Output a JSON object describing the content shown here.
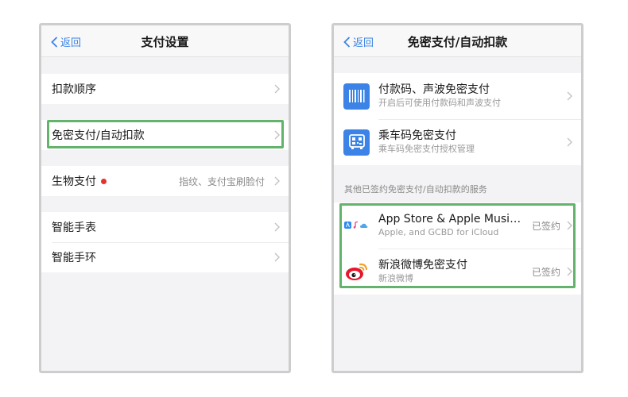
{
  "left": {
    "back_label": "返回",
    "title": "支付设置",
    "groups": [
      [
        {
          "label": "扣款顺序"
        }
      ],
      [
        {
          "label": "免密支付/自动扣款"
        }
      ],
      [
        {
          "label": "生物支付",
          "value": "指纹、支付宝刷脸付"
        }
      ],
      [
        {
          "label": "智能手表"
        },
        {
          "label": "智能手环"
        }
      ]
    ]
  },
  "right": {
    "back_label": "返回",
    "title": "免密支付/自动扣款",
    "top_items": [
      {
        "title": "付款码、声波免密支付",
        "subtitle": "开启后可使用付款码和声波支付",
        "icon": "barcode-icon"
      },
      {
        "title": "乘车码免密支付",
        "subtitle": "乘车码免密支付授权管理",
        "icon": "bus-qr-icon"
      }
    ],
    "section_label": "其他已签约免密支付/自动扣款的服务",
    "services": [
      {
        "title": "App Store & Apple Music...",
        "subtitle": "Apple, and GCBD for iCloud",
        "status": "已签约",
        "icon": "apple-services-icon"
      },
      {
        "title": "新浪微博免密支付",
        "subtitle": "新浪微博",
        "status": "已签约",
        "icon": "weibo-icon"
      }
    ]
  },
  "colors": {
    "accent_blue": "#3b83e6",
    "highlight_green": "#63b36c",
    "notice_red": "#e5322d"
  }
}
